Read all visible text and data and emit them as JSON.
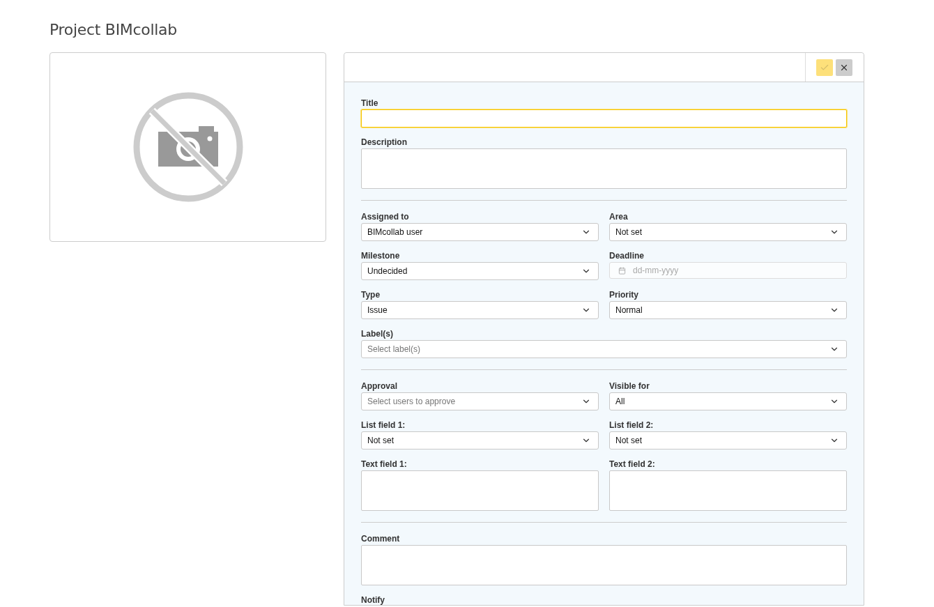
{
  "page_title": "Project BIMcollab",
  "form": {
    "sections": [
      {
        "rows": [
          [
            {
              "kind": "text",
              "label": "Title",
              "focused": true
            }
          ],
          [
            {
              "kind": "textarea",
              "label": "Description",
              "focused": false
            }
          ]
        ]
      },
      {
        "rows": [
          [
            {
              "kind": "select",
              "label": "Assigned to",
              "value": "BIMcollab user"
            },
            {
              "kind": "select",
              "label": "Area",
              "value": "Not set"
            }
          ],
          [
            {
              "kind": "select",
              "label": "Milestone",
              "value": "Undecided"
            },
            {
              "kind": "date",
              "label": "Deadline",
              "placeholder": "dd-mm-yyyy"
            }
          ],
          [
            {
              "kind": "select",
              "label": "Type",
              "value": "Issue"
            },
            {
              "kind": "select",
              "label": "Priority",
              "value": "Normal"
            }
          ],
          [
            {
              "kind": "select",
              "label": "Label(s)",
              "placeholder": "Select label(s)"
            }
          ]
        ]
      },
      {
        "rows": [
          [
            {
              "kind": "select",
              "label": "Approval",
              "placeholder": "Select users to approve"
            },
            {
              "kind": "select",
              "label": "Visible for",
              "value": "All"
            }
          ],
          [
            {
              "kind": "select",
              "label": "List field 1:",
              "value": "Not set"
            },
            {
              "kind": "select",
              "label": "List field 2:",
              "value": "Not set"
            }
          ],
          [
            {
              "kind": "textarea",
              "label": "Text field 1:",
              "focused": false
            },
            {
              "kind": "textarea",
              "label": "Text field 2:",
              "focused": false
            }
          ]
        ]
      },
      {
        "rows": [
          [
            {
              "kind": "textarea",
              "label": "Comment",
              "focused": false
            }
          ],
          [
            {
              "kind": "heading",
              "label": "Notify"
            }
          ]
        ]
      }
    ]
  }
}
